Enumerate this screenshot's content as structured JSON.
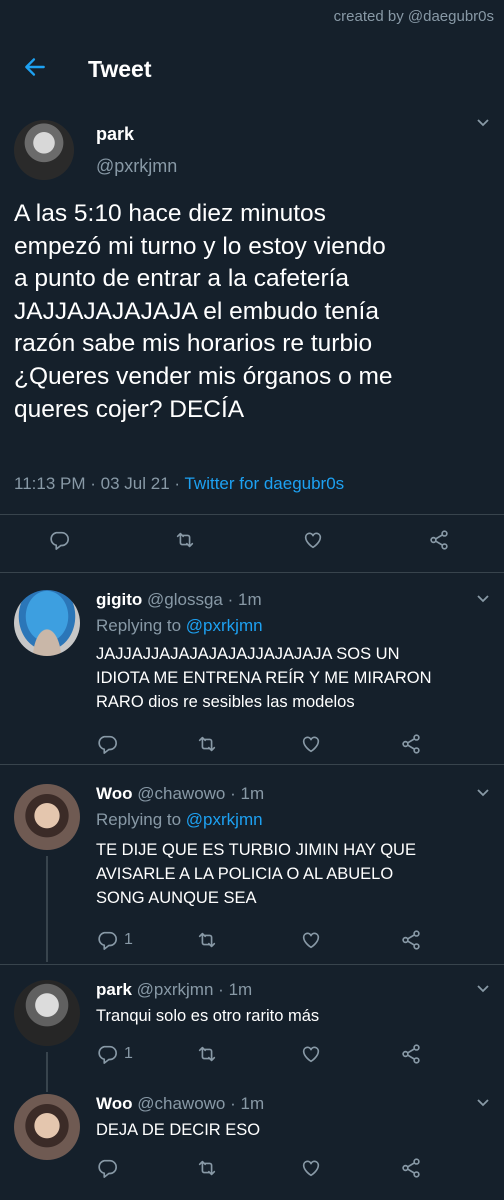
{
  "watermark": "created by @daegubr0s",
  "header": {
    "title": "Tweet"
  },
  "tweet": {
    "name": "park",
    "handle": "@pxrkjmn",
    "lines": [
      "A las 5:10 hace diez minutos",
      "empezó mi turno y lo estoy viendo",
      "a punto de entrar a la cafetería",
      "JAJJAJAJAJAJA el embudo tenía",
      "razón sabe mis horarios re turbio",
      "¿Queres vender mis órganos o me",
      "queres cojer? DECÍA"
    ],
    "time": "11:13 PM",
    "date": "03 Jul 21",
    "source": "Twitter for daegubr0s",
    "sep": "·"
  },
  "replies": [
    {
      "name": "gigito",
      "handle": "@glossga",
      "time": "1m",
      "replying_prefix": "Replying to",
      "replying_to": "@pxrkjmn",
      "lines": [
        "JAJJAJJAJAJAJAJAJJAJAJAJA SOS UN",
        "IDIOTA ME ENTRENA REÍR Y ME MIRARON",
        "RARO dios re sesibles las modelos"
      ],
      "reply_count": ""
    },
    {
      "name": "Woo",
      "handle": "@chawowo",
      "time": "1m",
      "replying_prefix": "Replying to",
      "replying_to": "@pxrkjmn",
      "lines": [
        "TE DIJE QUE ES TURBIO JIMIN HAY QUE",
        "AVISARLE A LA POLICIA O AL ABUELO",
        "SONG AUNQUE SEA"
      ],
      "reply_count": "1"
    },
    {
      "name": "park",
      "handle": "@pxrkjmn",
      "time": "1m",
      "lines": [
        "Tranqui solo es otro rarito más"
      ],
      "reply_count": "1"
    },
    {
      "name": "Woo",
      "handle": "@chawowo",
      "time": "1m",
      "lines": [
        "DEJA DE DECIR ESO"
      ],
      "reply_count": ""
    }
  ],
  "icons": [
    "back-arrow-icon",
    "chevron-down-icon",
    "reply-icon",
    "retweet-icon",
    "like-icon",
    "share-icon"
  ],
  "colors": {
    "background": "#15202b",
    "accent": "#1da1f2",
    "muted": "#8899a6",
    "divider": "#38444d"
  }
}
